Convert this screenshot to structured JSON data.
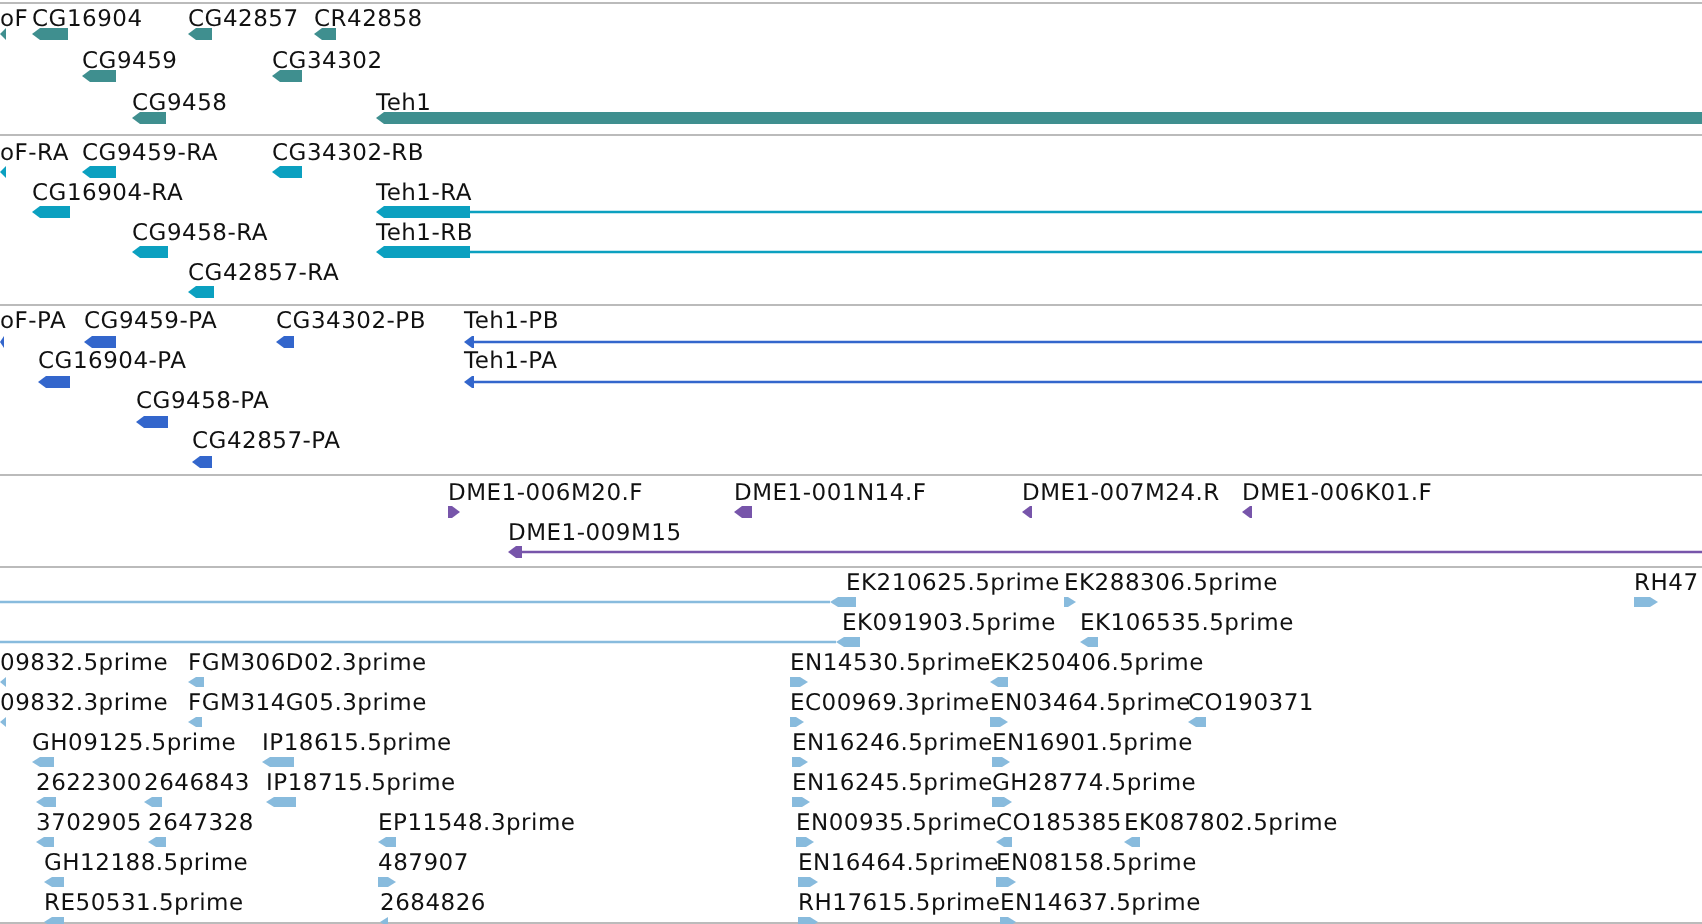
{
  "tracks": [
    {
      "color": "#3f8f8f",
      "features": [
        {
          "label": "oF",
          "reverse": true
        },
        {
          "label": "CG16904",
          "reverse": true
        },
        {
          "label": "CG42857",
          "reverse": true
        },
        {
          "label": "CR42858",
          "reverse": true
        },
        {
          "label": "CG9459",
          "reverse": true
        },
        {
          "label": "CG34302",
          "reverse": true
        },
        {
          "label": "CG9458",
          "reverse": true
        },
        {
          "label": "Teh1",
          "reverse": true
        }
      ]
    },
    {
      "color": "#0ba0c0",
      "features": [
        {
          "label": "oF-RA",
          "reverse": true
        },
        {
          "label": "CG9459-RA",
          "reverse": true
        },
        {
          "label": "CG34302-RB",
          "reverse": true
        },
        {
          "label": "CG16904-RA",
          "reverse": true
        },
        {
          "label": "Teh1-RA",
          "reverse": true
        },
        {
          "label": "CG9458-RA",
          "reverse": true
        },
        {
          "label": "Teh1-RB",
          "reverse": true
        },
        {
          "label": "CG42857-RA",
          "reverse": true
        }
      ]
    },
    {
      "color": "#3366cc",
      "features": [
        {
          "label": "oF-PA",
          "reverse": true
        },
        {
          "label": "CG9459-PA",
          "reverse": true
        },
        {
          "label": "CG34302-PB",
          "reverse": true
        },
        {
          "label": "Teh1-PB",
          "reverse": true
        },
        {
          "label": "CG16904-PA",
          "reverse": true
        },
        {
          "label": "Teh1-PA",
          "reverse": true
        },
        {
          "label": "CG9458-PA",
          "reverse": true
        },
        {
          "label": "CG42857-PA",
          "reverse": true
        }
      ]
    },
    {
      "color": "#7755aa",
      "features": [
        {
          "label": "DME1-006M20.F",
          "reverse": false
        },
        {
          "label": "DME1-001N14.F",
          "reverse": true
        },
        {
          "label": "DME1-007M24.R",
          "reverse": true
        },
        {
          "label": "DME1-006K01.F",
          "reverse": true
        },
        {
          "label": "DME1-009M15",
          "reverse": true
        }
      ]
    },
    {
      "color": "#88bbdd",
      "features": [
        {
          "label": "EK210625.5prime",
          "reverse": true
        },
        {
          "label": "EK288306.5prime",
          "reverse": false
        },
        {
          "label": "RH47",
          "reverse": false
        },
        {
          "label": "EK091903.5prime",
          "reverse": true
        },
        {
          "label": "EK106535.5prime",
          "reverse": true
        },
        {
          "label": "09832.5prime",
          "reverse": true
        },
        {
          "label": "FGM306D02.3prime",
          "reverse": true
        },
        {
          "label": "EN14530.5prime",
          "reverse": false
        },
        {
          "label": "EK250406.5prime",
          "reverse": true
        },
        {
          "label": "09832.3prime",
          "reverse": true
        },
        {
          "label": "FGM314G05.3prime",
          "reverse": true
        },
        {
          "label": "EC00969.3prime",
          "reverse": false
        },
        {
          "label": "EN03464.5prime",
          "reverse": false
        },
        {
          "label": "CO190371",
          "reverse": true
        },
        {
          "label": "GH09125.5prime",
          "reverse": true
        },
        {
          "label": "IP18615.5prime",
          "reverse": true
        },
        {
          "label": "EN16246.5prime",
          "reverse": false
        },
        {
          "label": "EN16901.5prime",
          "reverse": false
        },
        {
          "label": "2622300",
          "reverse": true
        },
        {
          "label": "2646843",
          "reverse": true
        },
        {
          "label": "IP18715.5prime",
          "reverse": true
        },
        {
          "label": "EN16245.5prime",
          "reverse": false
        },
        {
          "label": "GH28774.5prime",
          "reverse": false
        },
        {
          "label": "3702905",
          "reverse": true
        },
        {
          "label": "2647328",
          "reverse": true
        },
        {
          "label": "EP11548.3prime",
          "reverse": true
        },
        {
          "label": "EN00935.5prime",
          "reverse": false
        },
        {
          "label": "CO185385",
          "reverse": true
        },
        {
          "label": "EK087802.5prime",
          "reverse": true
        },
        {
          "label": "GH12188.5prime",
          "reverse": true
        },
        {
          "label": "487907",
          "reverse": false
        },
        {
          "label": "EN16464.5prime",
          "reverse": false
        },
        {
          "label": "EN08158.5prime",
          "reverse": false
        },
        {
          "label": "RE50531.5prime",
          "reverse": true
        },
        {
          "label": "2684826",
          "reverse": true
        },
        {
          "label": "RH17615.5prime",
          "reverse": false
        },
        {
          "label": "EN14637.5prime",
          "reverse": false
        }
      ]
    }
  ]
}
